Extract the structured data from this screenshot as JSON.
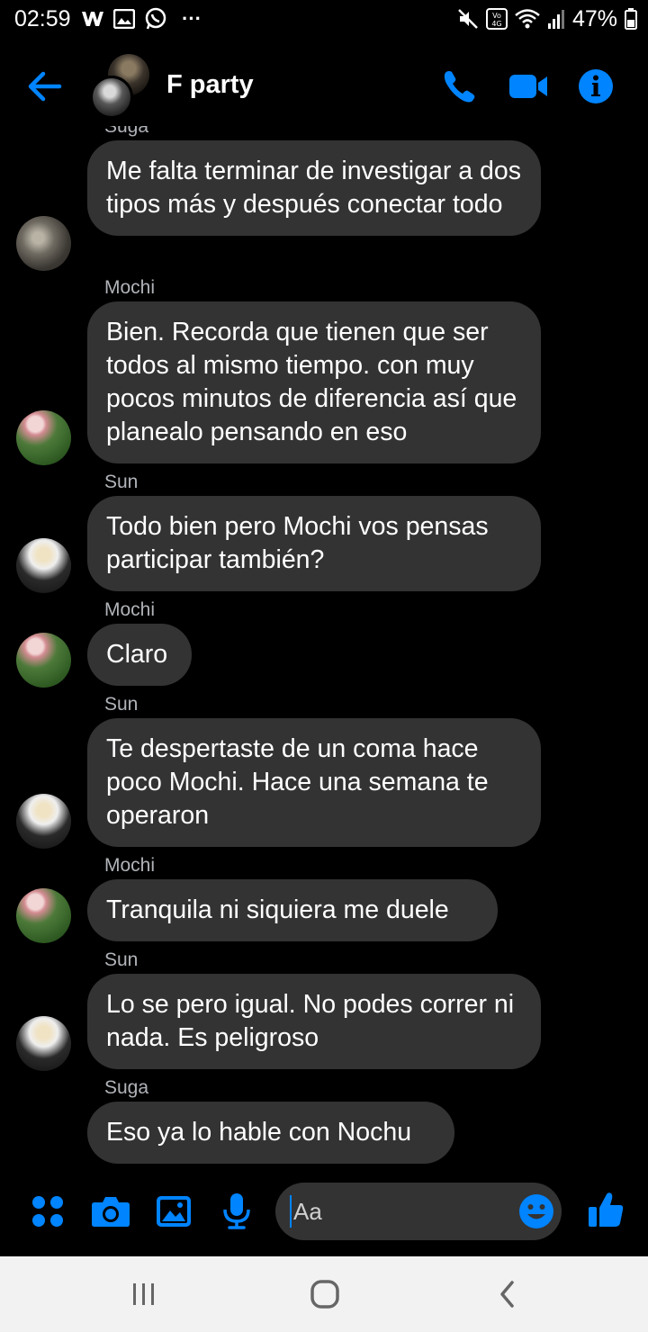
{
  "status_bar": {
    "time": "02:59",
    "battery_text": "47%",
    "more_text": "···"
  },
  "header": {
    "title": "F party"
  },
  "colors": {
    "accent": "#0084ff",
    "bubble": "#333334",
    "sender": "#b0b3b8"
  },
  "messages": {
    "cut_sender": "Suga",
    "items": [
      {
        "sender": "",
        "avatar": "suga",
        "text": "Me falta terminar de investigar a dos tipos más y después conectar todo"
      },
      {
        "sender": "Mochi",
        "avatar": "mochi",
        "text": "Bien. Recorda que tienen que ser todos al mismo tiempo. con muy pocos minutos de diferencia así que planealo pensando en eso"
      },
      {
        "sender": "Sun",
        "avatar": "sun",
        "text": "Todo bien pero Mochi vos pensas participar también?"
      },
      {
        "sender": "Mochi",
        "avatar": "mochi",
        "text": "Claro"
      },
      {
        "sender": "Sun",
        "avatar": "sun",
        "text": "Te despertaste de un coma hace poco Mochi. Hace una semana te operaron"
      },
      {
        "sender": "Mochi",
        "avatar": "mochi",
        "text": "Tranquila ni siquiera me duele"
      },
      {
        "sender": "Sun",
        "avatar": "sun",
        "text": "Lo se pero igual. No podes correr ni nada. Es peligroso"
      },
      {
        "sender": "Suga",
        "avatar": "none",
        "text": "Eso ya lo hable con Nochu"
      }
    ]
  },
  "composer": {
    "placeholder": "Aa"
  },
  "icons": [
    "back-arrow-icon",
    "phone-icon",
    "video-camera-icon",
    "info-icon",
    "menu-dots-icon",
    "camera-icon",
    "gallery-icon",
    "microphone-icon",
    "emoji-icon",
    "like-icon",
    "recent-apps-icon",
    "home-icon",
    "back-icon"
  ]
}
